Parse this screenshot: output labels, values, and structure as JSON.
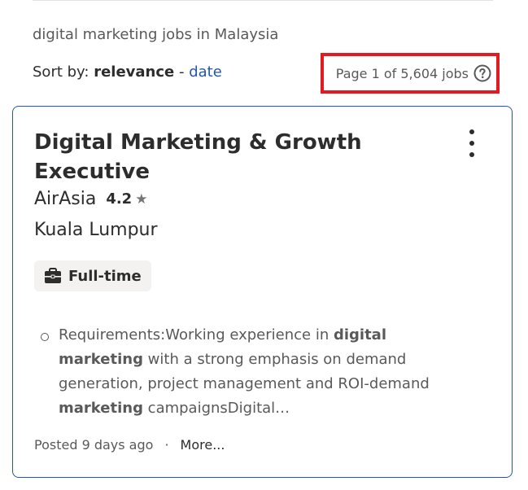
{
  "search": {
    "heading": "digital marketing jobs in Malaysia"
  },
  "sort": {
    "prefix": "Sort by: ",
    "active": "relevance",
    "separator": " - ",
    "alternate": "date"
  },
  "results": {
    "page_count": "Page 1 of 5,604 jobs"
  },
  "job": {
    "title": "Digital Marketing & Growth Executive",
    "company": "AirAsia",
    "rating": "4.2",
    "location": "Kuala Lumpur",
    "job_type": "Full-time",
    "snippet": {
      "t1": "Requirements:Working experience in ",
      "b1": "digital marketing",
      "t2": " with a strong emphasis on demand generation, project management and ROI-demand ",
      "b2": "marketing",
      "t3": " campaignsDigital…"
    },
    "posted": "Posted 9 days ago",
    "dot": "·",
    "more": "More..."
  },
  "icons": {
    "help": "question-circle-icon",
    "star": "star-icon",
    "briefcase": "briefcase-icon",
    "menu": "more-vertical-icon"
  },
  "colors": {
    "link": "#2557a7",
    "highlight_box": "#e21b23",
    "card_border": "#2557a7",
    "muted_text": "#595959"
  }
}
